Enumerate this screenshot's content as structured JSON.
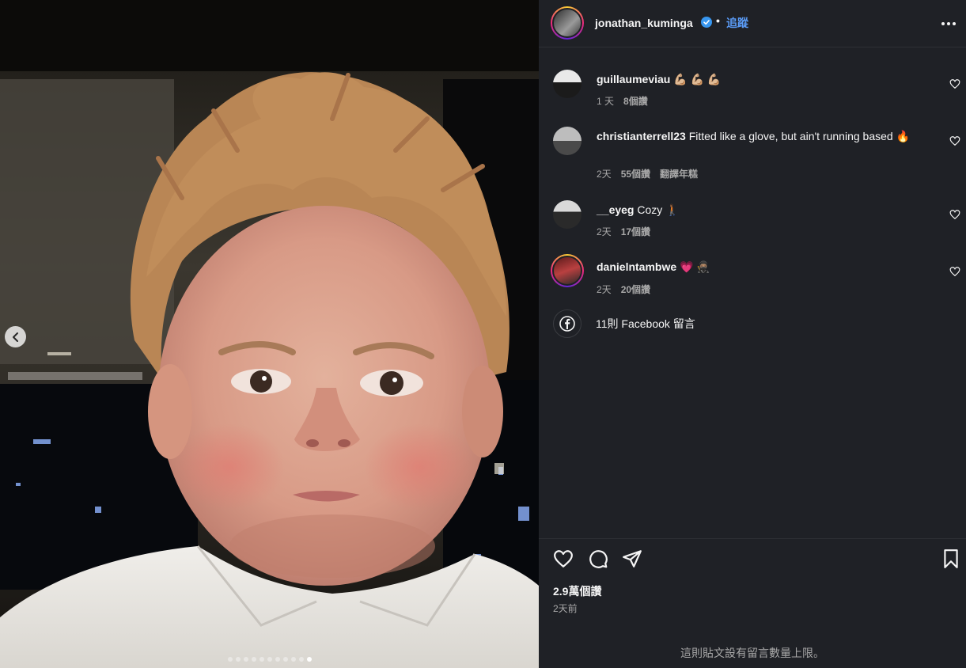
{
  "post": {
    "author": "jonathan_kuminga",
    "follow_label": "追蹤",
    "separator": "•",
    "likes": "2.9萬個讚",
    "posted_time": "2天前",
    "comment_limit_notice": "這則貼文設有留言數量上限。"
  },
  "media": {
    "carousel_count": 11,
    "active_index": 10,
    "accent_verified": "#3897f0"
  },
  "comments": [
    {
      "user": "guillaumeviau",
      "text": "💪🏼 💪🏼 💪🏼",
      "time": "1 天",
      "likes": "8個讚",
      "translate": ""
    },
    {
      "user": "christianterrell23",
      "text": "Fitted like a glove, but ain't running based 🔥",
      "time": "2天",
      "likes": "55個讚",
      "translate": "翻譯年糕"
    },
    {
      "user": "__eyeg",
      "text": "Cozy 🚶🏾",
      "time": "2天",
      "likes": "17個讚",
      "translate": ""
    },
    {
      "user": "danielntambwe",
      "text": "💗 🥷🏽",
      "time": "2天",
      "likes": "20個讚",
      "translate": ""
    }
  ],
  "facebook_comments": "11則 Facebook 留言",
  "icons": [
    "more-icon",
    "heart-icon",
    "comment-icon",
    "share-icon",
    "bookmark-icon",
    "facebook-icon",
    "chevron-left-icon",
    "verified-icon"
  ]
}
